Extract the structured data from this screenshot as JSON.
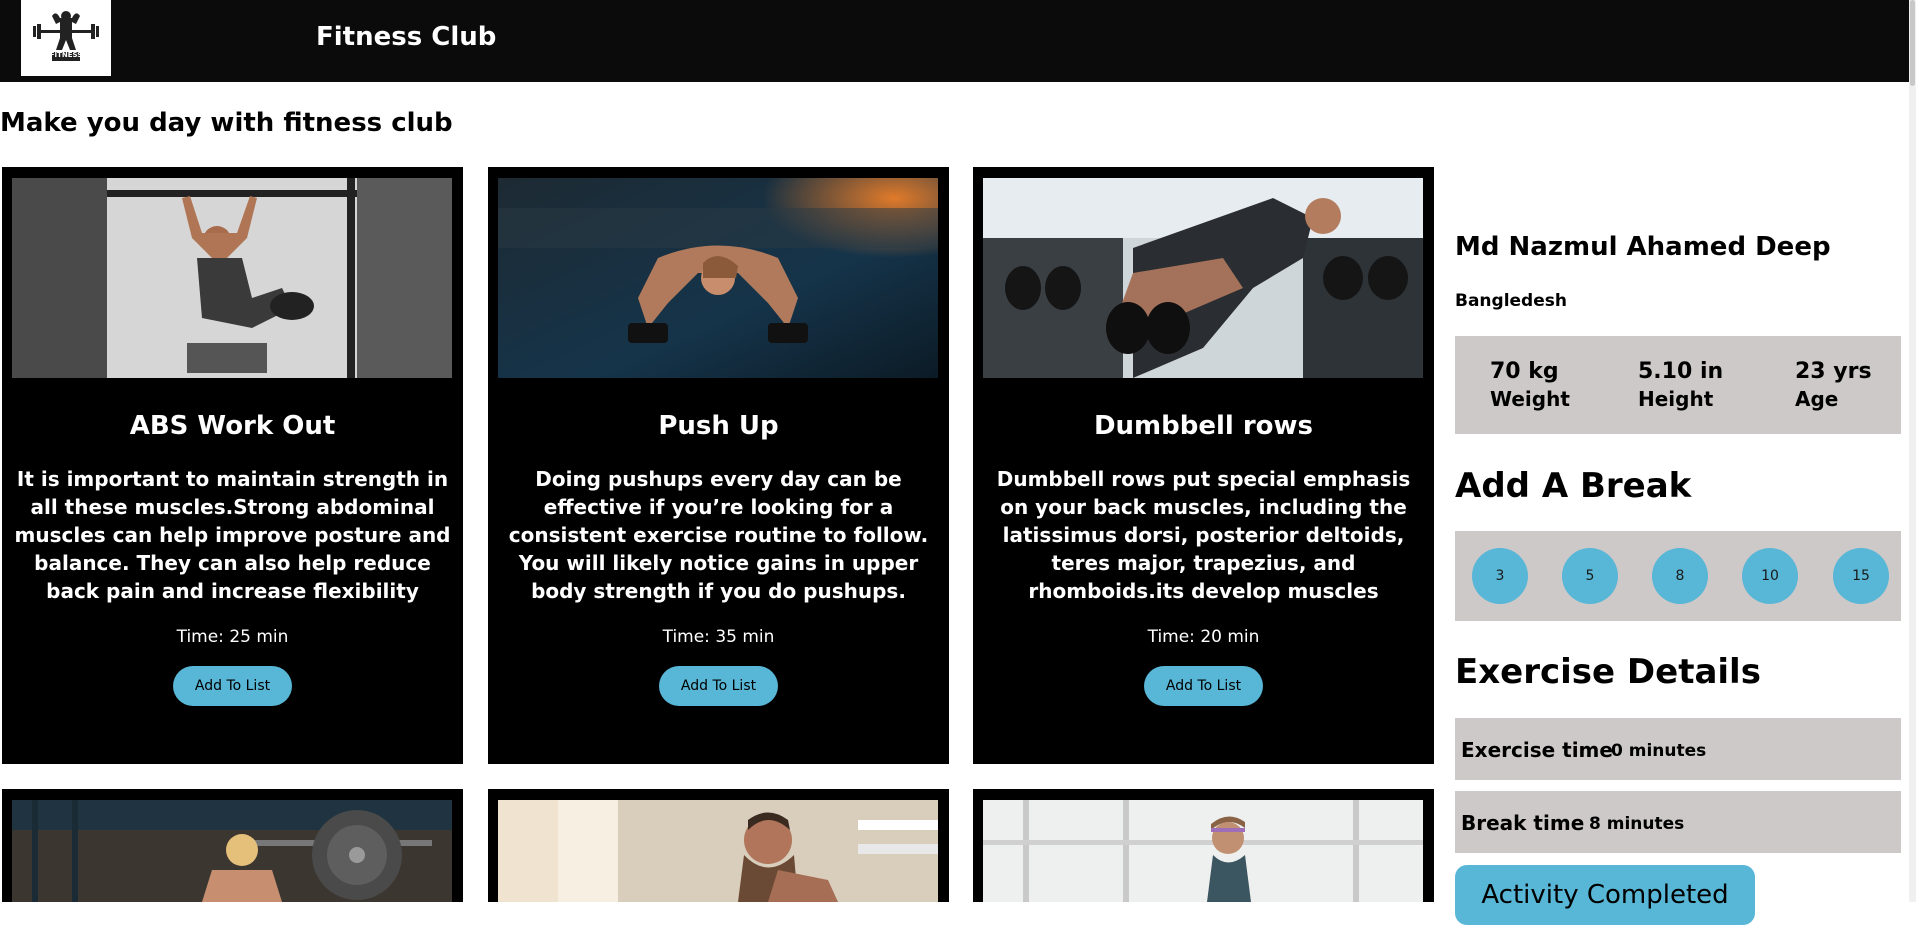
{
  "header": {
    "brand": "Fitness Club",
    "logo_text": "FITNESS"
  },
  "tagline": "Make you day with fitness club",
  "exercises": [
    {
      "title": "ABS Work Out",
      "description": "It is important to maintain strength in all these muscles.Strong abdominal muscles can help improve posture and balance. They can also help reduce back pain and increase flexibility",
      "time": "Time: 25 min",
      "button": "Add To List"
    },
    {
      "title": "Push Up",
      "description": "Doing pushups every day can be effective if you’re looking for a consistent exercise routine to follow. You will likely notice gains in upper body strength if you do pushups.",
      "time": "Time: 35 min",
      "button": "Add To List"
    },
    {
      "title": "Dumbbell rows",
      "description": "Dumbbell rows put special emphasis on your back muscles, including the latissimus dorsi, posterior deltoids, teres major, trapezius, and rhomboids.its develop muscles",
      "time": "Time: 20 min",
      "button": "Add To List"
    }
  ],
  "profile": {
    "name": "Md Nazmul Ahamed Deep",
    "country": "Bangledesh",
    "stats": [
      {
        "value": "70 kg",
        "label": "Weight"
      },
      {
        "value": "5.10 in",
        "label": "Height"
      },
      {
        "value": "23 yrs",
        "label": "Age"
      }
    ]
  },
  "break_section": {
    "heading": "Add A Break",
    "options": [
      "3",
      "5",
      "8",
      "10",
      "15"
    ]
  },
  "details": {
    "heading": "Exercise Details",
    "exercise_time_label": "Exercise time",
    "exercise_time_value": "0 minutes",
    "break_time_label": "Break time",
    "break_time_value": "8 minutes"
  },
  "complete_button": "Activity Completed",
  "colors": {
    "accent": "#58b6d6",
    "panel": "#cdc9c9",
    "card": "#000000",
    "navbar": "#0b0b0b"
  }
}
